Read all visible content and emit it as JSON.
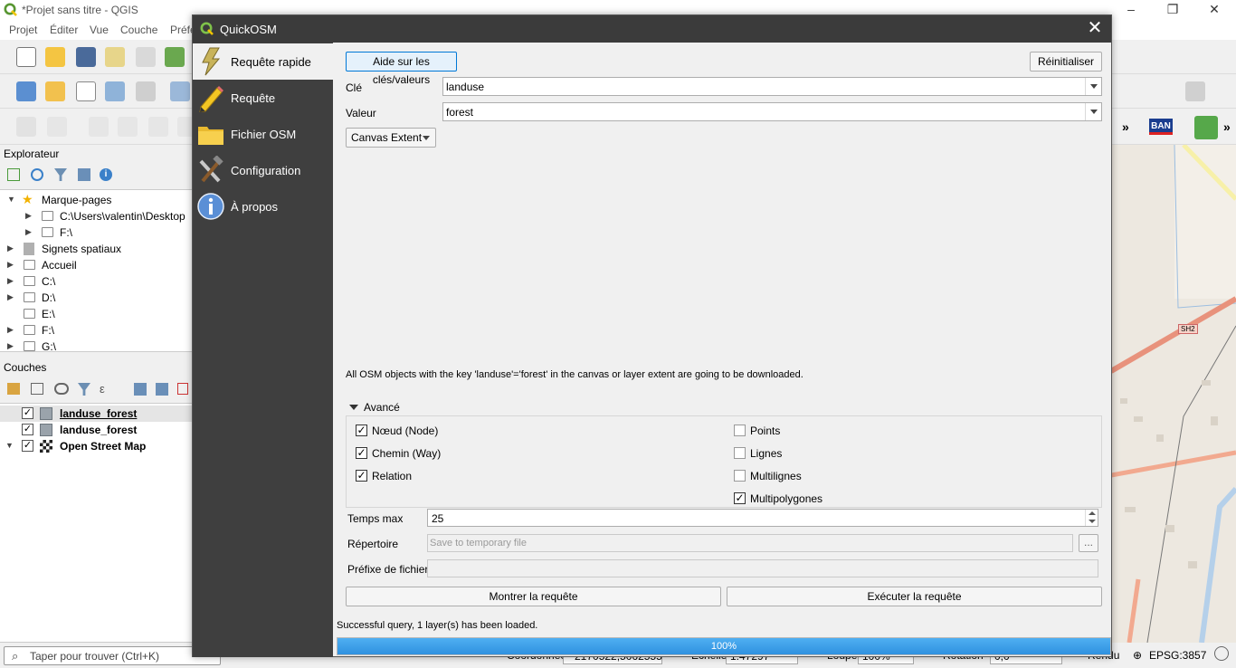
{
  "app": {
    "window_title": "*Projet sans titre - QGIS",
    "menu": [
      "Projet",
      "Éditer",
      "Vue",
      "Couche",
      "Préfé"
    ],
    "explorer": {
      "title": "Explorateur",
      "items": [
        {
          "label": "Marque-pages"
        },
        {
          "label": "C:\\Users\\valentin\\Desktop"
        },
        {
          "label": "F:\\"
        },
        {
          "label": "Signets spatiaux"
        },
        {
          "label": "Accueil"
        },
        {
          "label": "C:\\"
        },
        {
          "label": "D:\\"
        },
        {
          "label": "E:\\"
        },
        {
          "label": "F:\\"
        },
        {
          "label": "G:\\"
        }
      ]
    },
    "layers": {
      "title": "Couches",
      "items": [
        {
          "label": "landuse_forest",
          "checked": true
        },
        {
          "label": "landuse_forest",
          "checked": true
        },
        {
          "label": "Open Street Map",
          "checked": true
        }
      ]
    },
    "toolbar_right": {
      "ban_label": "BAN",
      "more_glyph": "»"
    },
    "status": {
      "search_placeholder": "Taper pour trouver (Ctrl+K)",
      "coord_label": "Coordonnée",
      "coord_value": "2170522,5062555",
      "scale_label": "Échelle",
      "scale_value": "1:47297",
      "magnifier_label": "Loupe",
      "magnifier_value": "100%",
      "rotation_label": "Rotation",
      "rotation_value": "0,0",
      "render_label": "Rendu",
      "crs": "EPSG:3857"
    },
    "map_labels": {
      "road": "SH2"
    }
  },
  "dialog": {
    "title": "QuickOSM",
    "close_glyph": "✕",
    "nav": [
      {
        "label": "Requête rapide",
        "icon": "lightning-icon",
        "active": true
      },
      {
        "label": "Requête",
        "icon": "pencil-icon",
        "active": false
      },
      {
        "label": "Fichier OSM",
        "icon": "folder-icon",
        "active": false
      },
      {
        "label": "Configuration",
        "icon": "tools-icon",
        "active": false
      },
      {
        "label": "À propos",
        "icon": "info-icon",
        "active": false
      }
    ],
    "help_button": "Aide sur les clés/valeurs",
    "reset_button": "Réinitialiser",
    "key_label": "Clé",
    "key_value": "landuse",
    "value_label": "Valeur",
    "value_value": "forest",
    "extent_option": "Canvas Extent",
    "info_text": "All OSM objects with the key 'landuse'='forest' in the canvas or layer extent are going to be downloaded.",
    "advanced": {
      "title": "Avancé",
      "left_checks": [
        {
          "label": "Nœud (Node)",
          "checked": true
        },
        {
          "label": "Chemin (Way)",
          "checked": true
        },
        {
          "label": "Relation",
          "checked": true
        }
      ],
      "right_checks": [
        {
          "label": "Points",
          "checked": false
        },
        {
          "label": "Lignes",
          "checked": false
        },
        {
          "label": "Multilignes",
          "checked": false
        },
        {
          "label": "Multipolygones",
          "checked": true
        }
      ]
    },
    "timeout_label": "Temps max",
    "timeout_value": "25",
    "dir_label": "Répertoire",
    "dir_placeholder": "Save to temporary file",
    "browse_button": "...",
    "prefix_label": "Préfixe de fichier",
    "prefix_value": "",
    "show_query_button": "Montrer la requête",
    "run_query_button": "Exécuter la requête",
    "status_text": "Successful query, 1 layer(s) has been loaded.",
    "progress_value": 100,
    "progress_text": "100%"
  },
  "colors": {
    "accent": "#0078d7",
    "progress": "#3a9ae8",
    "sidebar": "#3f3f3f",
    "qgis_green": "#589632"
  }
}
